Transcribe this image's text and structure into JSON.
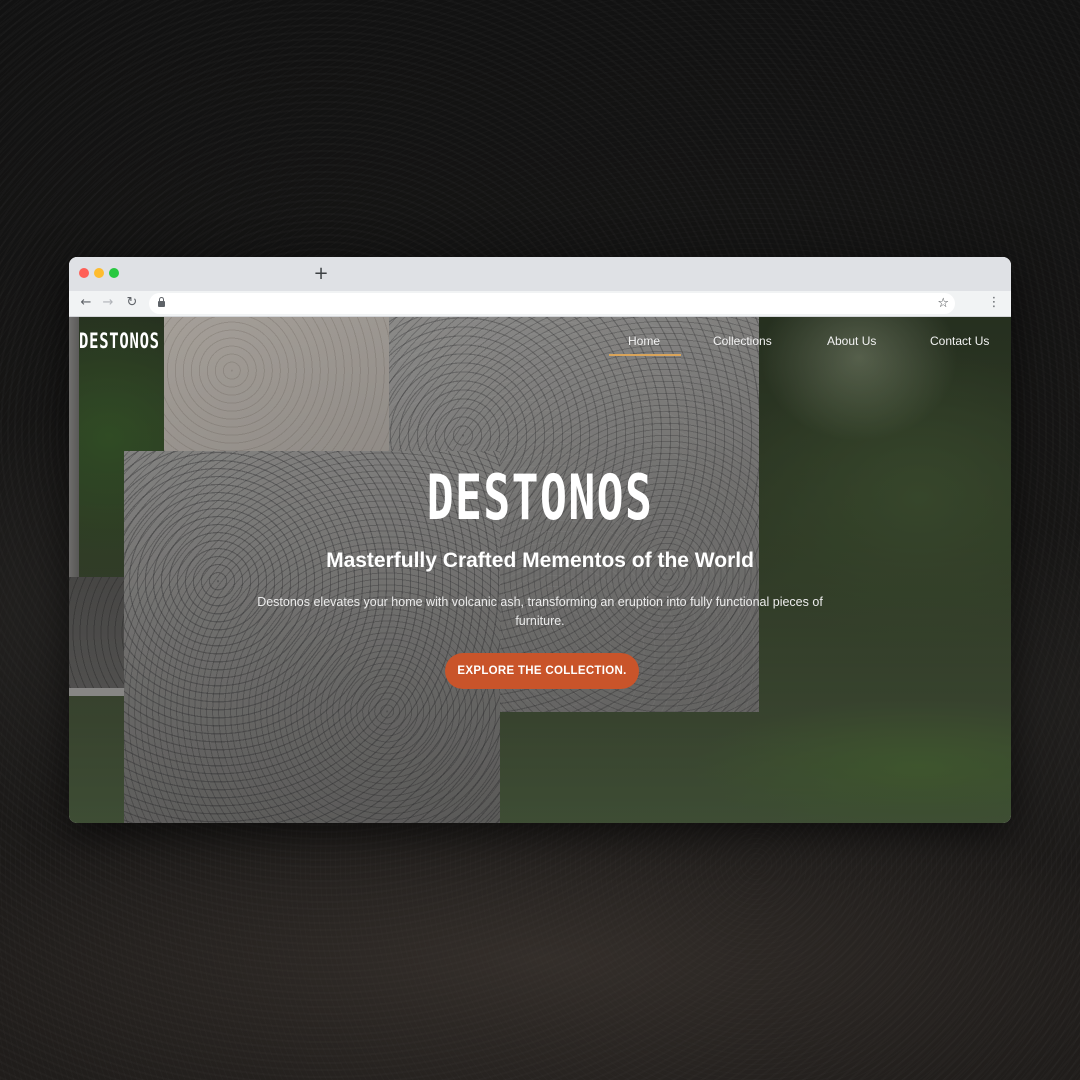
{
  "browser": {
    "new_tab_icon": "+",
    "back_icon": "←",
    "forward_icon": "→",
    "reload_icon": "↻",
    "url": "",
    "star_icon": "☆",
    "menu_icon": "⋮"
  },
  "site": {
    "logo": "DESTONOS",
    "nav": {
      "home": "Home",
      "collections": "Collections",
      "about": "About Us",
      "contact": "Contact Us",
      "active": "Home",
      "active_color": "#d9a45a"
    },
    "hero": {
      "logo": "DESTONOS",
      "title": "Masterfully Crafted Mementos of the World",
      "description": "Destonos elevates your home with volcanic ash, transforming an eruption into fully functional pieces of furniture.",
      "cta": "EXPLORE THE COLLECTION.",
      "cta_color": "#c9542a"
    }
  }
}
